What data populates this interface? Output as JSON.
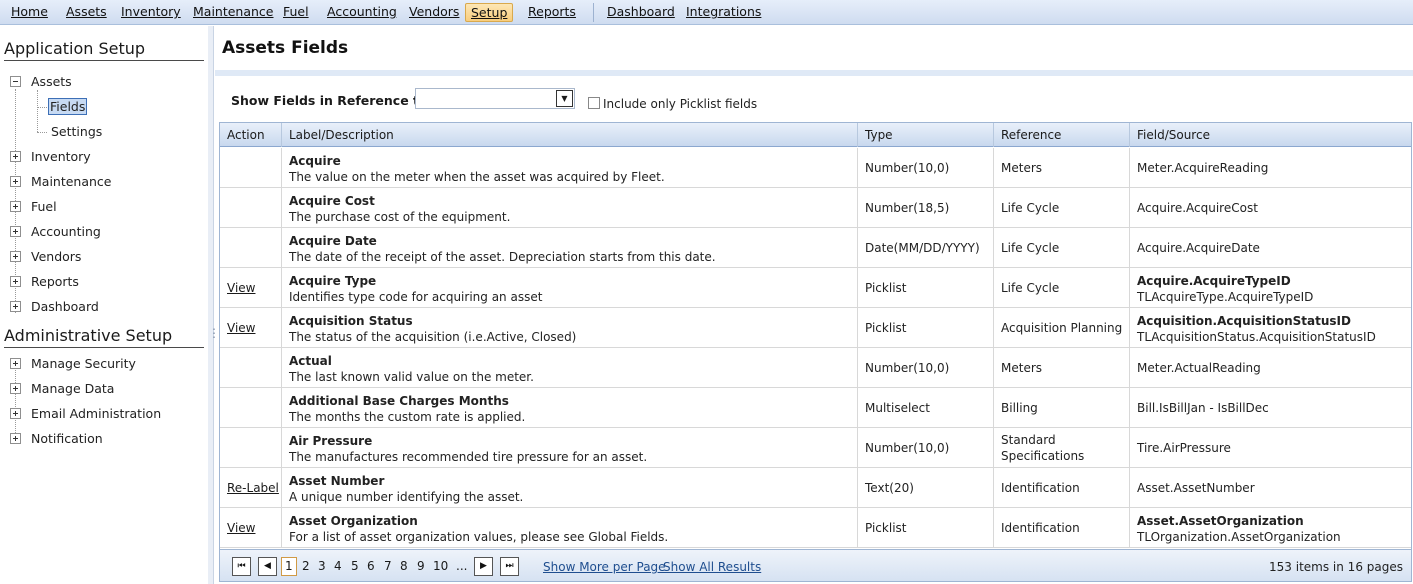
{
  "menu": {
    "items": [
      "Home",
      "Assets",
      "Inventory",
      "Maintenance",
      "Fuel",
      "Accounting",
      "Vendors",
      "Setup",
      "Reports",
      "Dashboard",
      "Integrations"
    ],
    "active": "Setup"
  },
  "sidebar": {
    "app_setup_heading": "Application Setup",
    "admin_setup_heading": "Administrative Setup",
    "assets_label": "Assets",
    "fields_label": "Fields",
    "settings_label": "Settings",
    "app_items": [
      "Inventory",
      "Maintenance",
      "Fuel",
      "Accounting",
      "Vendors",
      "Reports",
      "Dashboard"
    ],
    "admin_items": [
      "Manage Security",
      "Manage Data",
      "Email Administration",
      "Notification"
    ]
  },
  "main": {
    "title": "Assets Fields",
    "filter_label": "Show Fields in Reference to:",
    "filter_value": "",
    "picklist_only_label": "Include only Picklist fields",
    "picklist_only_checked": false
  },
  "grid": {
    "columns": [
      "Action",
      "Label/Description",
      "Type",
      "Reference",
      "Field/Source"
    ],
    "rows": [
      {
        "action": "",
        "label": "Acquire",
        "description": "The value on the meter when the asset was acquired by Fleet.",
        "type": "Number(10,0)",
        "reference": "Meters",
        "source_bold": "",
        "source": "Meter.AcquireReading"
      },
      {
        "action": "",
        "label": "Acquire Cost",
        "description": "The purchase cost of the equipment.",
        "type": "Number(18,5)",
        "reference": "Life Cycle",
        "source_bold": "",
        "source": "Acquire.AcquireCost"
      },
      {
        "action": "",
        "label": "Acquire Date",
        "description": "The date of the receipt of the asset. Depreciation starts from this date.",
        "type": "Date(MM/DD/YYYY)",
        "reference": "Life Cycle",
        "source_bold": "",
        "source": "Acquire.AcquireDate"
      },
      {
        "action": "View",
        "label": "Acquire Type",
        "description": "Identifies type code for acquiring an asset",
        "type": "Picklist",
        "reference": "Life Cycle",
        "source_bold": "Acquire.AcquireTypeID",
        "source": "TLAcquireType.AcquireTypeID"
      },
      {
        "action": "View",
        "label": "Acquisition Status",
        "description": "The status of the acquisition (i.e.Active, Closed)",
        "type": "Picklist",
        "reference": "Acquisition Planning",
        "source_bold": "Acquisition.AcquisitionStatusID",
        "source": "TLAcquisitionStatus.AcquisitionStatusID"
      },
      {
        "action": "",
        "label": "Actual",
        "description": "The last known valid value on the meter.",
        "type": "Number(10,0)",
        "reference": "Meters",
        "source_bold": "",
        "source": "Meter.ActualReading"
      },
      {
        "action": "",
        "label": "Additional Base Charges Months",
        "description": "The months the custom rate is applied.",
        "type": "Multiselect",
        "reference": "Billing",
        "source_bold": "",
        "source": "Bill.IsBillJan - IsBillDec"
      },
      {
        "action": "",
        "label": "Air Pressure",
        "description": "The manufactures recommended tire pressure for an asset.",
        "type": "Number(10,0)",
        "reference": "Standard Specifications",
        "source_bold": "",
        "source": "Tire.AirPressure"
      },
      {
        "action": "Re-Label",
        "label": "Asset Number",
        "description": "A unique number identifying the asset.",
        "type": "Text(20)",
        "reference": "Identification",
        "source_bold": "",
        "source": "Asset.AssetNumber"
      },
      {
        "action": "View",
        "label": "Asset Organization",
        "description": "For a list of asset organization values, please see Global Fields.",
        "type": "Picklist",
        "reference": "Identification",
        "source_bold": "Asset.AssetOrganization",
        "source": "TLOrganization.AssetOrganization"
      }
    ]
  },
  "pager": {
    "first_icon": "first-page-icon",
    "prev_icon": "prev-page-icon",
    "next_icon": "next-page-icon",
    "last_icon": "last-page-icon",
    "pages": [
      "1",
      "2",
      "3",
      "4",
      "5",
      "6",
      "7",
      "8",
      "9",
      "10",
      "..."
    ],
    "current": "1",
    "show_more_label": "Show More per Page",
    "show_all_label": "Show All Results",
    "summary": "153 items in 16 pages"
  }
}
